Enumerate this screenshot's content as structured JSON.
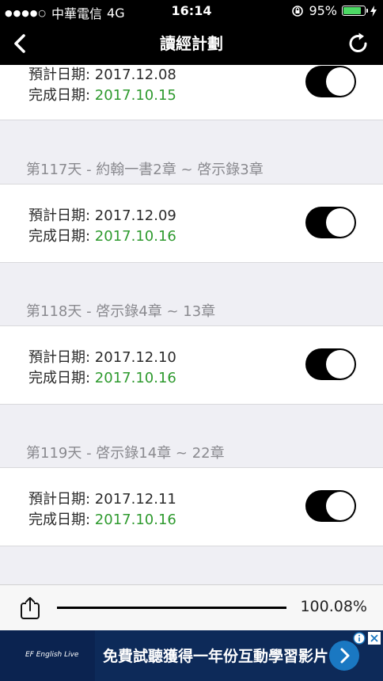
{
  "status_bar": {
    "signal_dots": "●●●●○",
    "carrier": "中華電信",
    "network": "4G",
    "time": "16:14",
    "battery": "95%",
    "battery_level": 0.95
  },
  "nav": {
    "title": "讀經計劃",
    "back_icon": "chevron-left-icon",
    "refresh_icon": "refresh-icon"
  },
  "colors": {
    "completed_date": "#2e9a2e",
    "toggle_on": "#000000",
    "ad_background": "#0d2a59"
  },
  "entries": [
    {
      "header": "",
      "planned": "預計日期: 2017.12.08",
      "done_label": "完成日期: ",
      "done_date": "2017.10.15",
      "toggle_on": true
    },
    {
      "header": "第117天 - 約翰一書2章 ~ 啓示錄3章",
      "planned": "預計日期: 2017.12.09",
      "done_label": "完成日期: ",
      "done_date": "2017.10.16",
      "toggle_on": true
    },
    {
      "header": "第118天 - 啓示錄4章 ~ 13章",
      "planned": "預計日期: 2017.12.10",
      "done_label": "完成日期: ",
      "done_date": "2017.10.16",
      "toggle_on": true
    },
    {
      "header": "第119天 - 啓示錄14章 ~ 22章",
      "planned": "預計日期: 2017.12.11",
      "done_label": "完成日期: ",
      "done_date": "2017.10.16",
      "toggle_on": true
    }
  ],
  "bottom": {
    "share_icon": "share-icon",
    "progress_percent": "100.08%"
  },
  "ad": {
    "logo": "EF English Live",
    "text": "免費試聽獲得一年份互動學習影片",
    "arrow_icon": "chevron-right-icon"
  }
}
